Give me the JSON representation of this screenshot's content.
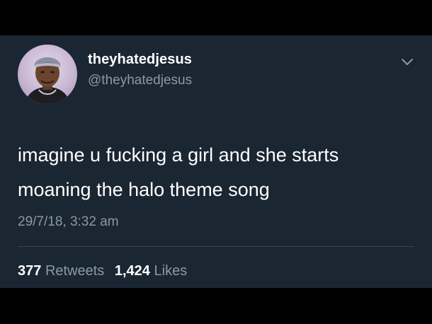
{
  "tweet": {
    "display_name": "theyhatedjesus",
    "handle": "@theyhatedjesus",
    "text": "imagine u fucking a girl and she starts\nmoaning the halo theme song",
    "timestamp": "29/7/18, 3:32 am",
    "stats": {
      "retweets_count": "377",
      "retweets_label": "Retweets",
      "likes_count": "1,424",
      "likes_label": "Likes"
    }
  },
  "icons": {
    "menu": "chevron-down-icon",
    "avatar": "avatar"
  },
  "colors": {
    "page_background": "#000000",
    "card_background": "#1b2633",
    "primary_text": "#ffffff",
    "secondary_text": "#8899a6",
    "divider": "#38444d"
  }
}
